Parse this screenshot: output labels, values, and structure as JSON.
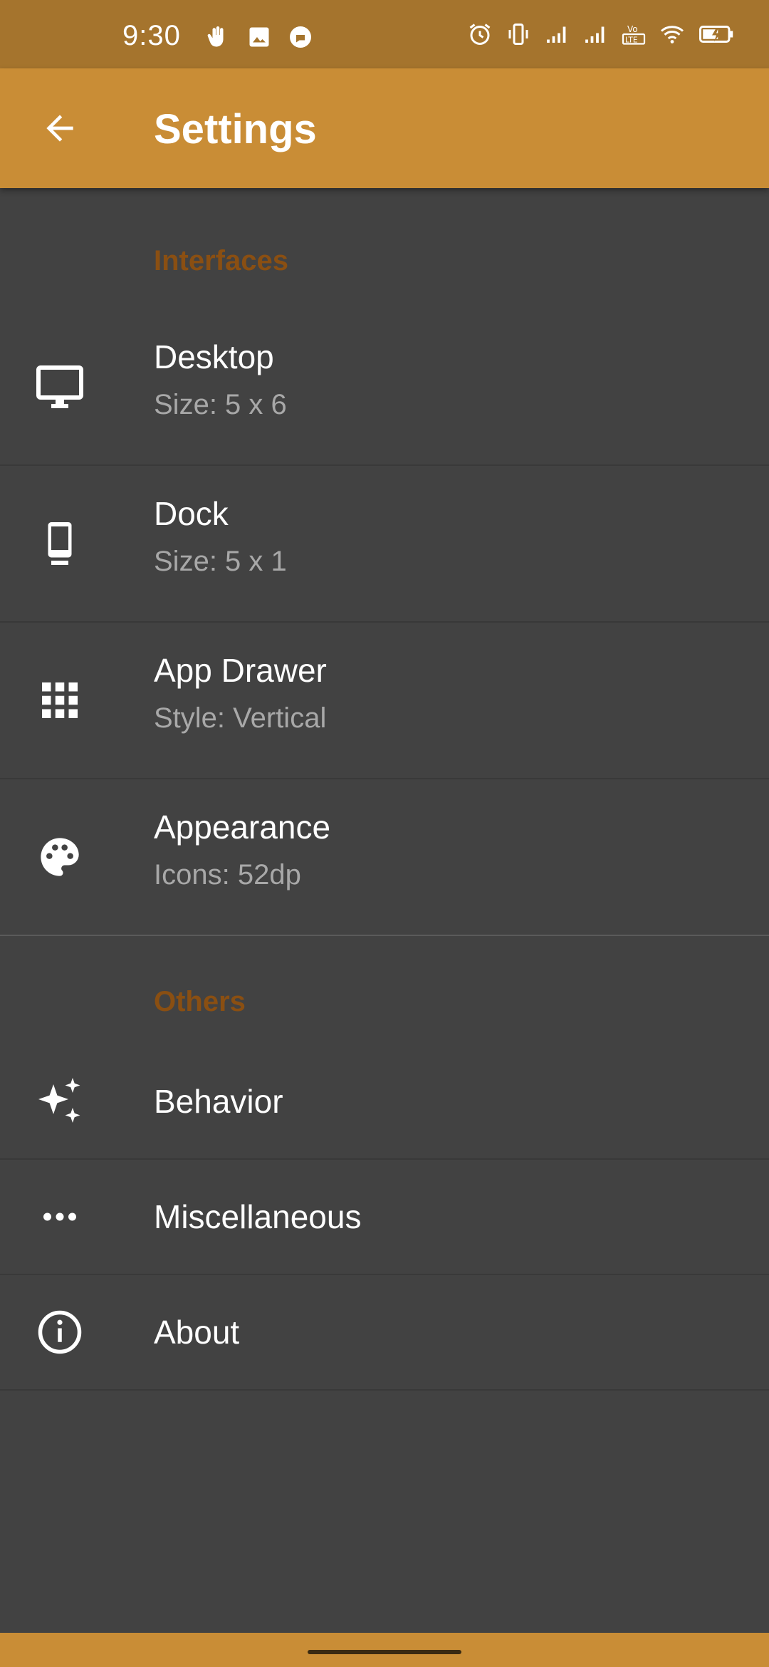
{
  "status": {
    "time": "9:30",
    "lte_label": "LTE",
    "vo_label": "Vo"
  },
  "appbar": {
    "title": "Settings"
  },
  "sections": [
    {
      "header": "Interfaces",
      "items": [
        {
          "title": "Desktop",
          "subtitle": "Size: 5 x 6",
          "icon": "monitor-icon"
        },
        {
          "title": "Dock",
          "subtitle": "Size: 5 x 1",
          "icon": "phone-dock-icon"
        },
        {
          "title": "App Drawer",
          "subtitle": "Style: Vertical",
          "icon": "grid-icon"
        },
        {
          "title": "Appearance",
          "subtitle": "Icons: 52dp",
          "icon": "palette-icon"
        }
      ]
    },
    {
      "header": "Others",
      "items": [
        {
          "title": "Behavior",
          "icon": "sparkles-icon"
        },
        {
          "title": "Miscellaneous",
          "icon": "more-horizontal-icon"
        },
        {
          "title": "About",
          "icon": "info-icon"
        }
      ]
    }
  ],
  "colors": {
    "statusbar": "#a5742d",
    "appbar": "#c98d36",
    "background": "#424242",
    "section_header": "#8a4f12",
    "subtitle": "#a8a8a8"
  }
}
